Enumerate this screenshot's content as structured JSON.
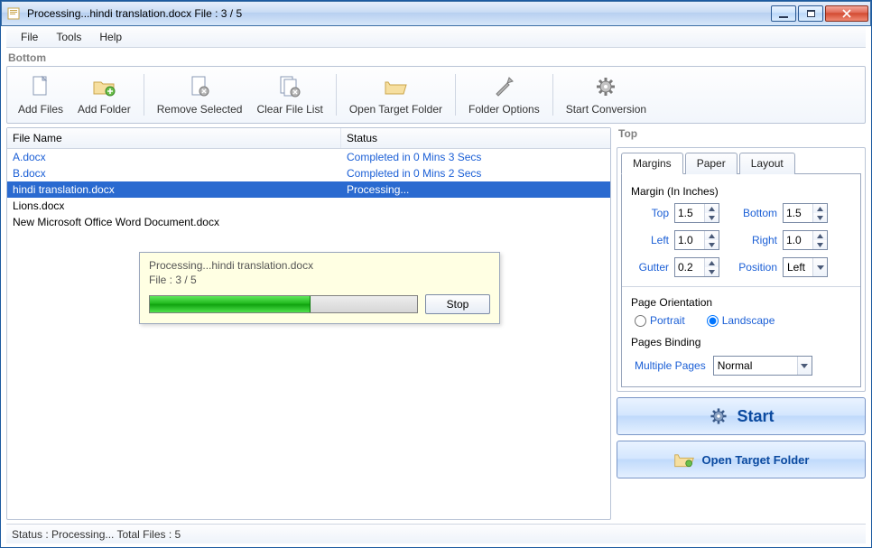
{
  "titlebar": {
    "text": "Processing...hindi translation.docx File : 3 / 5"
  },
  "menu": {
    "file": "File",
    "tools": "Tools",
    "help": "Help"
  },
  "panel_labels": {
    "bottom": "Bottom",
    "top": "Top"
  },
  "toolbar": {
    "add_files": "Add Files",
    "add_folder": "Add Folder",
    "remove_selected": "Remove Selected",
    "clear_list": "Clear File List",
    "open_target": "Open Target Folder",
    "folder_options": "Folder Options",
    "start_conversion": "Start Conversion"
  },
  "grid": {
    "headers": {
      "file_name": "File Name",
      "status": "Status"
    },
    "rows": [
      {
        "name": "A.docx",
        "status": "Completed in 0 Mins 3 Secs",
        "style": "link"
      },
      {
        "name": "B.docx",
        "status": "Completed in 0 Mins 2 Secs",
        "style": "link"
      },
      {
        "name": "hindi translation.docx",
        "status": "Processing...",
        "style": "sel"
      },
      {
        "name": "Lions.docx",
        "status": "",
        "style": "plain"
      },
      {
        "name": "New Microsoft Office Word Document.docx",
        "status": "",
        "style": "plain"
      }
    ]
  },
  "progress": {
    "line1": "Processing...hindi translation.docx",
    "line2": "File : 3 / 5",
    "stop": "Stop"
  },
  "tabs": {
    "margins": "Margins",
    "paper": "Paper",
    "layout": "Layout"
  },
  "margins": {
    "group": "Margin (In Inches)",
    "top_l": "Top",
    "top_v": "1.5",
    "bottom_l": "Bottom",
    "bottom_v": "1.5",
    "left_l": "Left",
    "left_v": "1.0",
    "right_l": "Right",
    "right_v": "1.0",
    "gutter_l": "Gutter",
    "gutter_v": "0.2",
    "position_l": "Position",
    "position_v": "Left"
  },
  "orientation": {
    "label": "Page Orientation",
    "portrait": "Portrait",
    "landscape": "Landscape",
    "selected": "landscape"
  },
  "binding": {
    "label": "Pages Binding",
    "multiple": "Multiple Pages",
    "value": "Normal"
  },
  "buttons": {
    "start": "Start",
    "open_target": "Open Target Folder"
  },
  "statusbar": {
    "text": "Status :  Processing...  Total Files : 5"
  }
}
